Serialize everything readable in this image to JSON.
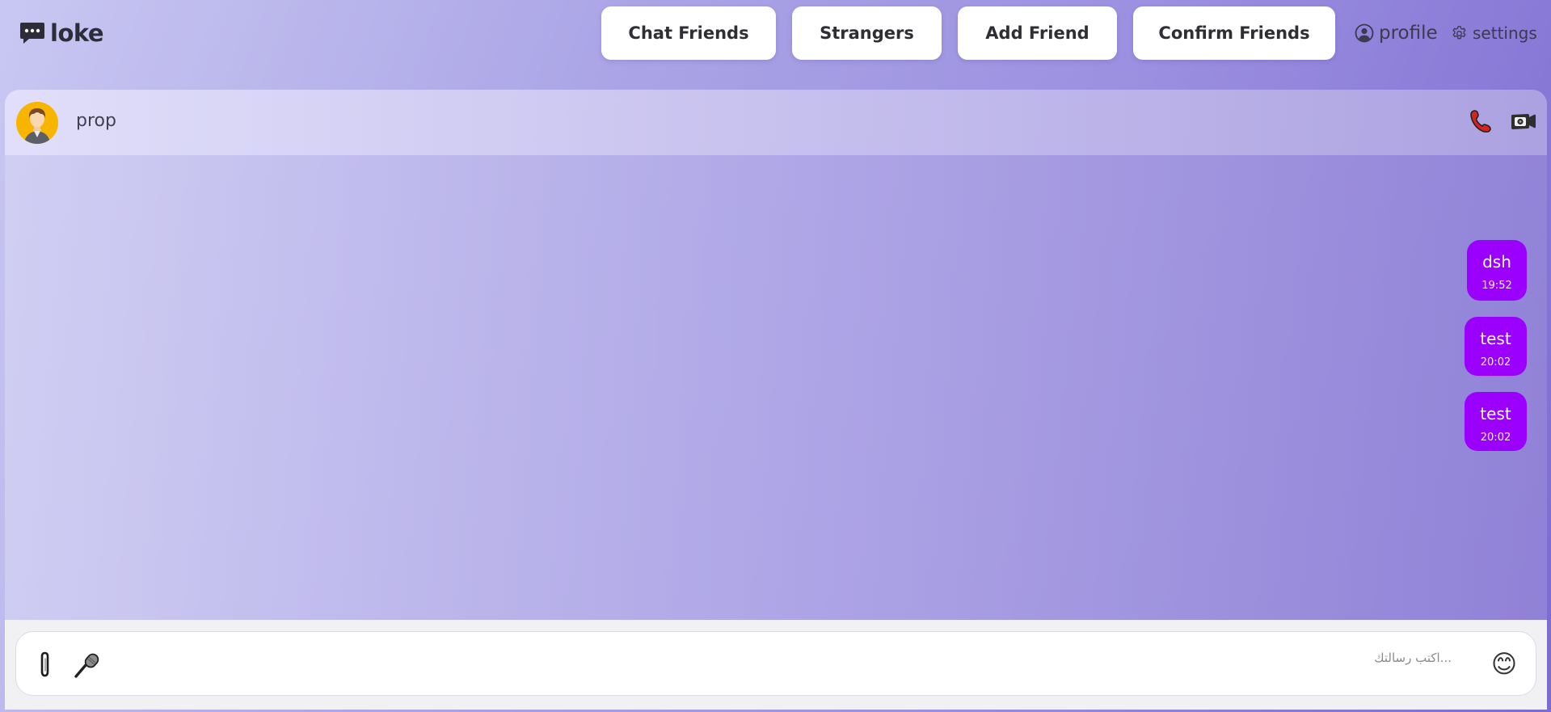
{
  "app": {
    "name": "loke",
    "logo_icon": "chat-bubble-icon"
  },
  "nav": {
    "buttons": [
      {
        "label": "Chat Friends"
      },
      {
        "label": "Strangers"
      },
      {
        "label": "Add Friend"
      },
      {
        "label": "Confirm Friends"
      }
    ],
    "profile_label": "profile",
    "settings_label": "settings"
  },
  "chat": {
    "contact_name": "prop",
    "header_icons": [
      "phone-icon",
      "camera-icon"
    ],
    "messages": [
      {
        "text": "dsh",
        "time": "19:52"
      },
      {
        "text": "test",
        "time": "20:02"
      },
      {
        "text": "test",
        "time": "20:02"
      }
    ]
  },
  "composer": {
    "placeholder": "...اكتب رسالتك",
    "value": "",
    "emoji": "😊",
    "icons": [
      "paperclip-icon",
      "microphone-icon",
      "smiley-icon"
    ]
  },
  "colors": {
    "bubble": "#9b00ff",
    "avatar_bg": "#f7b500",
    "accent_gradient_end": "#7c6bd0"
  }
}
